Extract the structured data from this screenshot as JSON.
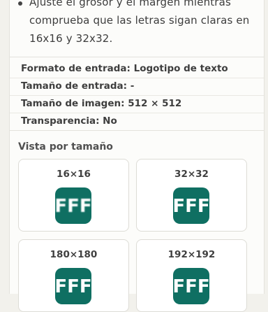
{
  "tips": {
    "lines": [
      "Ajuste el grosor y el margen mientras",
      "comprueba que las letras sigan claras en",
      "16x16 y 32x32."
    ]
  },
  "meta": {
    "input_format": "Formato de entrada: Logotipo de texto",
    "input_size": "Tamaño de entrada: -",
    "image_size": "Tamaño de imagen: 512 × 512",
    "transparency": "Transparencia: No"
  },
  "preview": {
    "title": "Vista por tamaño",
    "cards": [
      {
        "label": "16×16",
        "icon_text": "FFF"
      },
      {
        "label": "32×32",
        "icon_text": "FFF"
      },
      {
        "label": "180×180",
        "icon_text": "FFF"
      },
      {
        "label": "192×192",
        "icon_text": "FFF"
      }
    ]
  },
  "colors": {
    "icon_bg": "#0f6f62",
    "icon_fg": "#ffffff",
    "page_bg": "#f2f1ec"
  }
}
